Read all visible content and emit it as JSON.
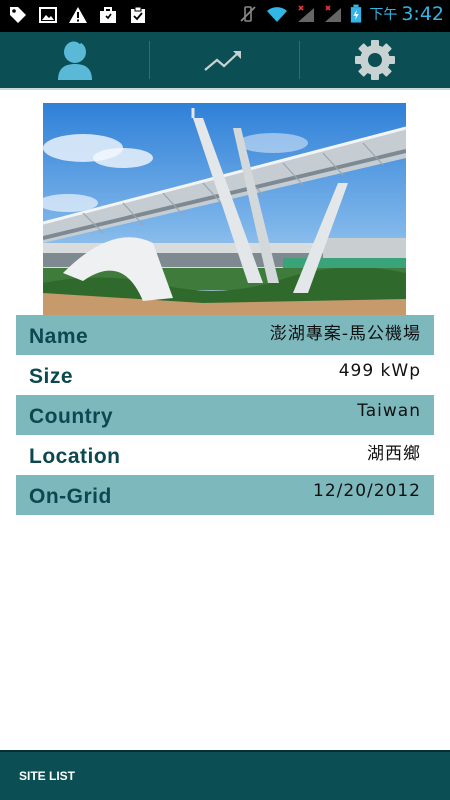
{
  "status_bar": {
    "time_period": "下午",
    "time": "3:42",
    "left_icons": [
      "tag-icon",
      "image-icon",
      "warning-icon",
      "briefcase-icon",
      "clipboard-check-icon"
    ],
    "right_icons": [
      "vibrate-mute-icon",
      "wifi-icon",
      "signal-x-icon",
      "signal-x-icon",
      "battery-charging-icon"
    ]
  },
  "tabs": [
    {
      "name": "profile",
      "icon": "person-icon"
    },
    {
      "name": "trend",
      "icon": "trend-chart-icon"
    },
    {
      "name": "settings",
      "icon": "gear-icon"
    }
  ],
  "site": {
    "fields": [
      {
        "label": "Name",
        "value": "澎湖專案-馬公機場"
      },
      {
        "label": "Size",
        "value": "499 kWp"
      },
      {
        "label": "Country",
        "value": "Taiwan"
      },
      {
        "label": "Location",
        "value": "湖西鄉"
      },
      {
        "label": "On-Grid",
        "value": "12/20/2012"
      }
    ]
  },
  "bottom_bar": {
    "site_list_label": "SITE LIST"
  },
  "colors": {
    "primary_dark": "#0b4f54",
    "row_shade": "#7db8bd",
    "label_text": "#0b4850",
    "time_accent": "#33b5e5"
  }
}
